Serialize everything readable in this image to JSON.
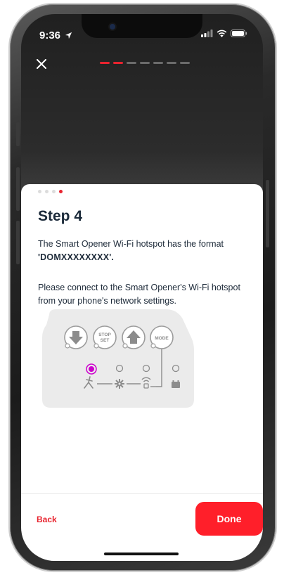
{
  "status_bar": {
    "time": "9:36"
  },
  "header": {
    "progress_total": 7,
    "progress_current": 2
  },
  "card": {
    "page_dots_total": 4,
    "page_dots_current": 4,
    "title": "Step 4",
    "paragraph1_prefix": "The Smart Opener Wi-Fi hotspot has the format ",
    "hotspot_format": "'DOMXXXXXXXX'.",
    "paragraph2": "Please connect to the Smart Opener's Wi-Fi hotspot from your phone's network settings.",
    "panel": {
      "buttons": [
        "STOP\nSET",
        "MODE"
      ],
      "stop_top": "STOP",
      "stop_bottom": "SET",
      "mode_label": "MODE",
      "active_led_color": "#cc00cc"
    }
  },
  "footer": {
    "back_label": "Back",
    "done_label": "Done"
  },
  "colors": {
    "accent": "#e8232e",
    "button": "#ff1f2a",
    "text": "#1e2b3a"
  }
}
